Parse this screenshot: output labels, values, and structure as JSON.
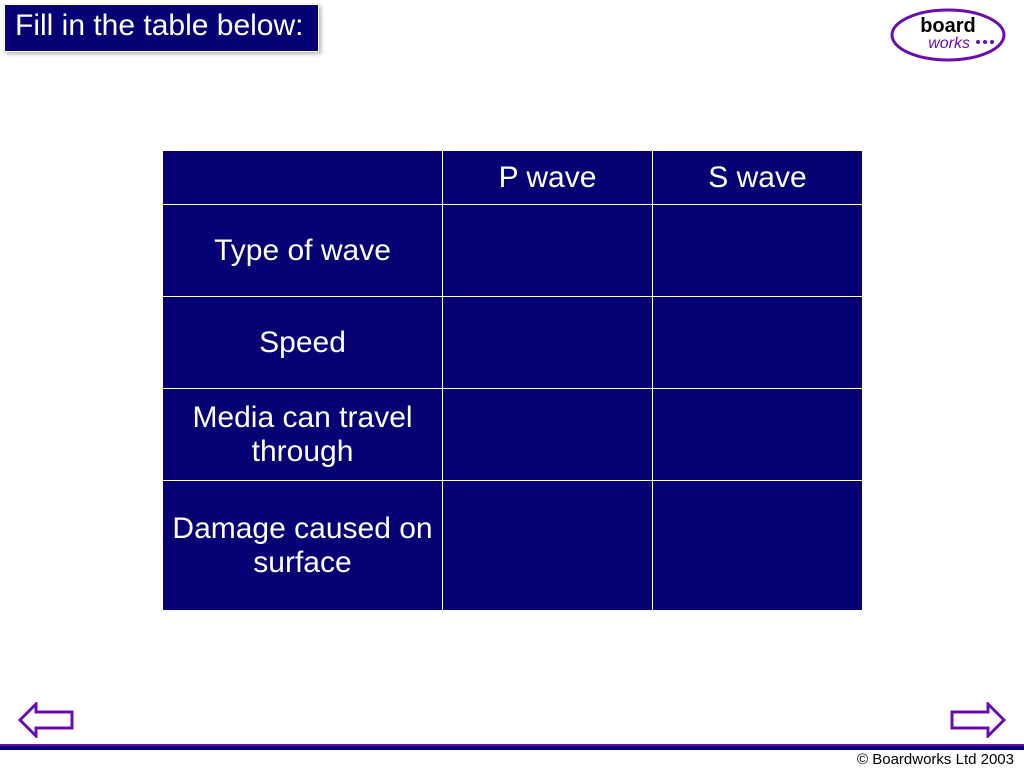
{
  "title": "Fill in the table below:",
  "logo": {
    "top_text": "board",
    "bottom_text": "works"
  },
  "table": {
    "header": {
      "blank": "",
      "col1": "P wave",
      "col2": "S wave"
    },
    "rows": [
      {
        "label": "Type of wave",
        "col1": "",
        "col2": ""
      },
      {
        "label": "Speed",
        "col1": "",
        "col2": ""
      },
      {
        "label": "Media can travel through",
        "col1": "",
        "col2": ""
      },
      {
        "label": "Damage caused on surface",
        "col1": "",
        "col2": ""
      }
    ]
  },
  "footer": {
    "copyright": "© Boardworks Ltd 2003"
  }
}
